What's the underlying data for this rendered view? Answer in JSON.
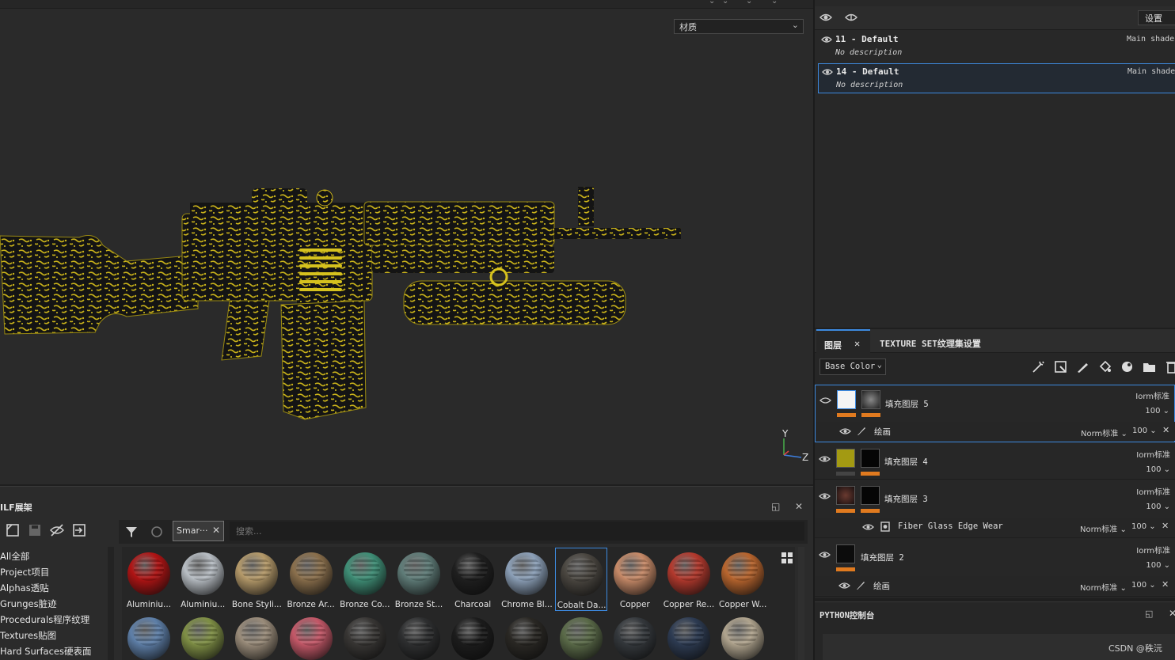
{
  "viewport": {
    "material_dropdown": "材质",
    "axis_y": "Y",
    "axis_z": "Z"
  },
  "shelf": {
    "title": "ILF展架",
    "search_tag": "Smar···",
    "search_placeholder": "搜索...",
    "categories": [
      "All全部",
      "Project项目",
      "Alphas透贴",
      "Grunges脏迹",
      "Procedurals程序纹理",
      "Textures贴图",
      "Hard Surfaces硬表面"
    ],
    "materials_row1": [
      {
        "label": "Aluminiu...",
        "color": "#b01414"
      },
      {
        "label": "Aluminiu...",
        "color": "#b8bec4"
      },
      {
        "label": "Bone Styli...",
        "color": "#b59a6a"
      },
      {
        "label": "Bronze Ar...",
        "color": "#8a6f4c"
      },
      {
        "label": "Bronze Co...",
        "color": "#3f8e76"
      },
      {
        "label": "Bronze St...",
        "color": "#5f7c78"
      },
      {
        "label": "Charcoal",
        "color": "#1f1f1f"
      },
      {
        "label": "Chrome Bl...",
        "color": "#8ca0b8"
      },
      {
        "label": "Cobalt Da...",
        "color": "#4a4640"
      },
      {
        "label": "Copper",
        "color": "#c78a68"
      },
      {
        "label": "Copper Re...",
        "color": "#b3392d"
      },
      {
        "label": "Copper W...",
        "color": "#b8652e"
      }
    ],
    "materials_row2": [
      {
        "color": "#5e7fa8"
      },
      {
        "color": "#7f8f45"
      },
      {
        "color": "#9a8c7a"
      },
      {
        "color": "#c45868"
      },
      {
        "color": "#383634"
      },
      {
        "color": "#2e2f30"
      },
      {
        "color": "#1c1c1c"
      },
      {
        "color": "#2a2824"
      },
      {
        "color": "#5a6a48"
      },
      {
        "color": "#34383c"
      },
      {
        "color": "#2d3b52"
      },
      {
        "color": "#b0a48e"
      }
    ]
  },
  "texture_sets": {
    "settings_label": "设置",
    "items": [
      {
        "name": "11 - Default",
        "description": "No description",
        "shader": "Main shade"
      },
      {
        "name": "14 - Default",
        "description": "No description",
        "shader": "Main shade"
      }
    ]
  },
  "layers": {
    "tab_layers": "图层",
    "tab_texture_settings": "TEXTURE SET纹理集设置",
    "channel": "Base Color",
    "items": [
      {
        "name": "填充图层 5",
        "blend": "Iorm标准",
        "opacity": "100",
        "sub": {
          "name": "绘画",
          "blend": "Norm标准",
          "opacity": "100"
        }
      },
      {
        "name": "填充图层 4",
        "blend": "Iorm标准",
        "opacity": "100"
      },
      {
        "name": "填充图层 3",
        "blend": "Iorm标准",
        "opacity": "100",
        "sub": {
          "name": "Fiber Glass Edge Wear",
          "blend": "Norm标准",
          "opacity": "100"
        }
      },
      {
        "name": "填充图层 2",
        "blend": "Iorm标准",
        "opacity": "100",
        "sub": {
          "name": "绘画",
          "blend": "Norm标准",
          "opacity": "100"
        }
      }
    ]
  },
  "python": {
    "title": "PYTHON控制台"
  },
  "watermark": "CSDN @秩沅",
  "colors": {
    "accent": "#3d8ae0",
    "orange": "#e07a1f",
    "gun_yellow": "#c9b21a"
  }
}
